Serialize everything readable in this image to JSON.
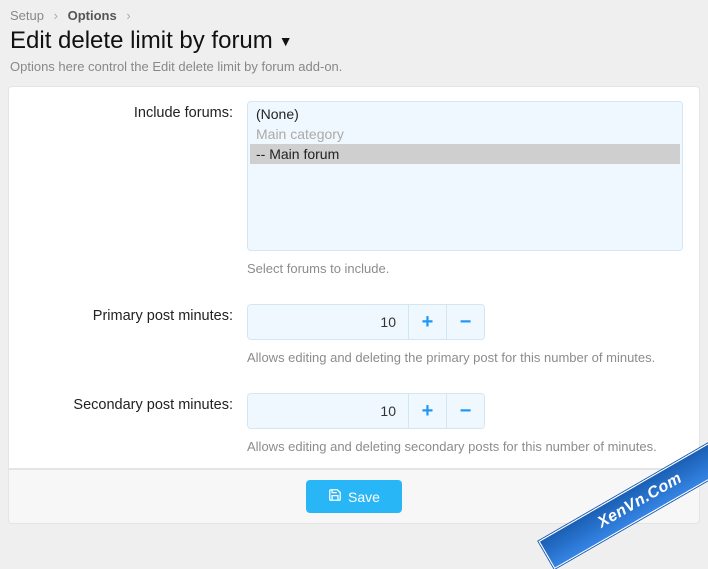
{
  "breadcrumb": {
    "items": [
      {
        "label": "Setup"
      },
      {
        "label": "Options",
        "current": true
      }
    ]
  },
  "page": {
    "title": "Edit delete limit by forum",
    "description": "Options here control the Edit delete limit by forum add-on."
  },
  "form": {
    "includeForums": {
      "label": "Include forums:",
      "options": [
        {
          "label": "(None)",
          "selected": false,
          "disabled": false
        },
        {
          "label": "Main category",
          "selected": false,
          "disabled": true
        },
        {
          "label": "-- Main forum",
          "selected": true,
          "disabled": false
        }
      ],
      "help": "Select forums to include."
    },
    "primaryMinutes": {
      "label": "Primary post minutes:",
      "value": "10",
      "help": "Allows editing and deleting the primary post for this number of minutes."
    },
    "secondaryMinutes": {
      "label": "Secondary post minutes:",
      "value": "10",
      "help": "Allows editing and deleting secondary posts for this number of minutes."
    }
  },
  "buttons": {
    "save": "Save"
  },
  "watermark": "XenVn.Com"
}
